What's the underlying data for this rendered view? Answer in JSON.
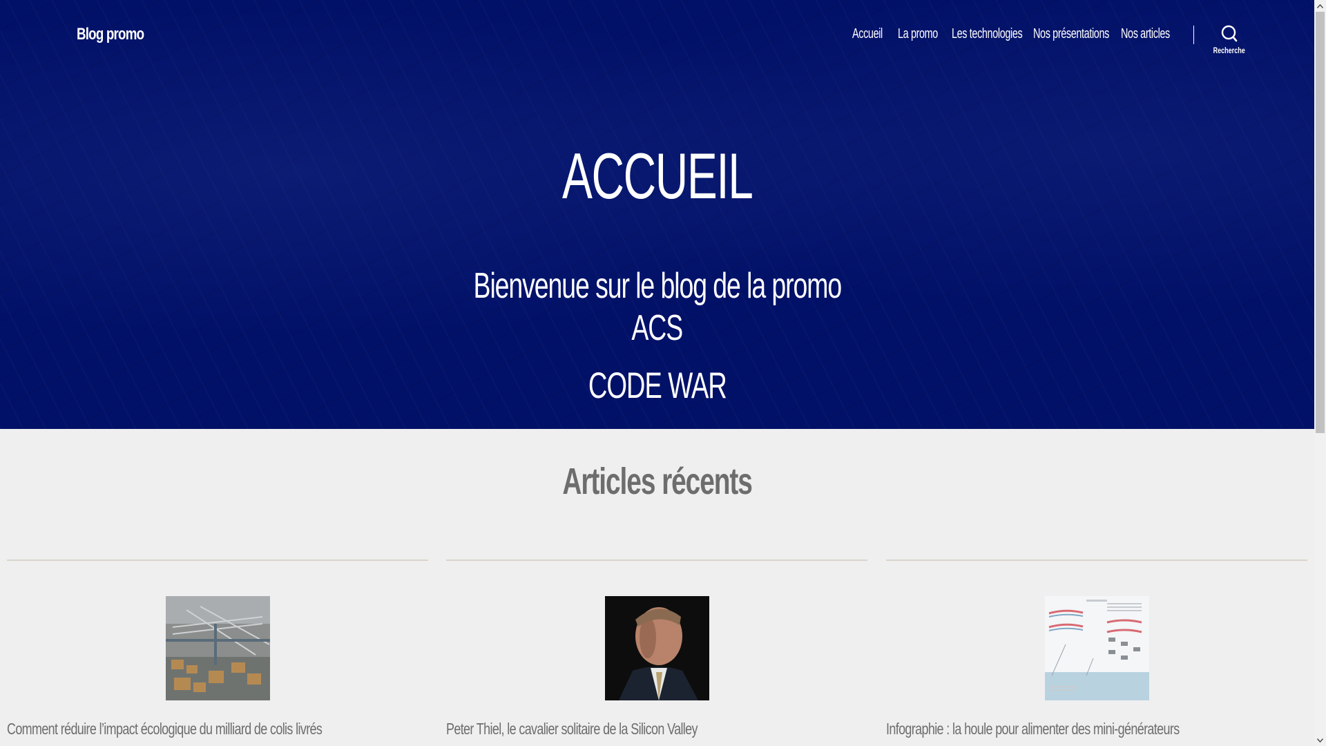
{
  "header": {
    "site_title": "Blog promo",
    "nav": [
      "Accueil",
      "La promo",
      "Les technologies",
      "Nos présentations",
      "Nos articles"
    ],
    "search_label": "Recherche",
    "search_icon": "search-icon"
  },
  "hero": {
    "heading": "ACCUEIL",
    "subtitle_line1": "Bienvenue sur le blog de la promo",
    "subtitle_line2": "ACS",
    "code": "CODE WAR",
    "background_color": "#021168"
  },
  "recent": {
    "title": "Articles récents",
    "articles": [
      {
        "title": "Comment réduire l’impact écologique du milliard de colis livrés",
        "image": "warehouse-photo"
      },
      {
        "title": "Peter Thiel, le cavalier solitaire de la Silicon Valley",
        "image": "portrait-photo"
      },
      {
        "title": "Infographie : la houle pour alimenter des mini-générateurs",
        "image": "infographic-image"
      }
    ]
  }
}
